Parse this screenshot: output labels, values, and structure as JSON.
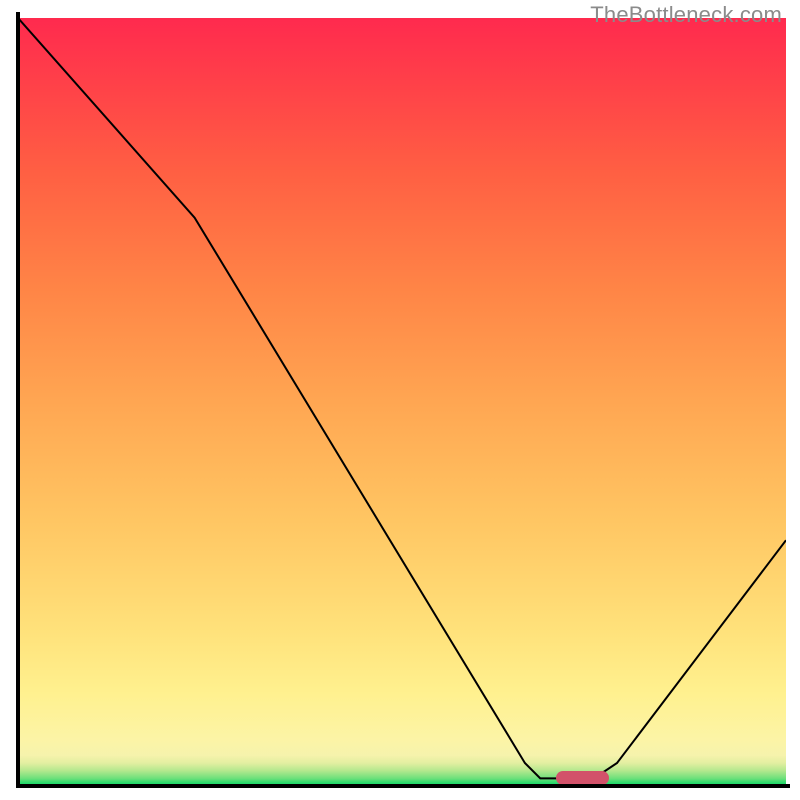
{
  "watermark": "TheBottleneck.com",
  "chart_data": {
    "type": "line",
    "title": "",
    "xlabel": "",
    "ylabel": "",
    "xlim": [
      0,
      100
    ],
    "ylim": [
      0,
      100
    ],
    "background_gradient": {
      "stops": [
        {
          "pct": 0,
          "color": "#00d763"
        },
        {
          "pct": 1,
          "color": "#6ee07b"
        },
        {
          "pct": 2,
          "color": "#b4e88e"
        },
        {
          "pct": 3,
          "color": "#e3efa1"
        },
        {
          "pct": 4,
          "color": "#f6f3ac"
        },
        {
          "pct": 6,
          "color": "#fcf4a6"
        },
        {
          "pct": 12,
          "color": "#fff18f"
        },
        {
          "pct": 20,
          "color": "#ffe27b"
        },
        {
          "pct": 35,
          "color": "#ffc562"
        },
        {
          "pct": 50,
          "color": "#ffa652"
        },
        {
          "pct": 65,
          "color": "#ff8446"
        },
        {
          "pct": 80,
          "color": "#ff5f43"
        },
        {
          "pct": 92,
          "color": "#ff3f49"
        },
        {
          "pct": 100,
          "color": "#ff2a4e"
        }
      ]
    },
    "series": [
      {
        "name": "bottleneck-curve",
        "points": [
          {
            "x": 0,
            "y": 100
          },
          {
            "x": 23,
            "y": 74
          },
          {
            "x": 66,
            "y": 3
          },
          {
            "x": 68,
            "y": 1
          },
          {
            "x": 75,
            "y": 1
          },
          {
            "x": 78,
            "y": 3
          },
          {
            "x": 100,
            "y": 32
          }
        ]
      }
    ],
    "marker": {
      "name": "highlight-segment",
      "color": "#d2526a",
      "x_start": 70,
      "x_end": 77,
      "y": 1
    }
  }
}
